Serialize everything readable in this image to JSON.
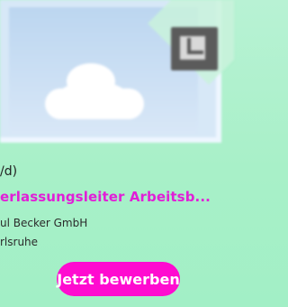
{
  "job": {
    "gender_suffix": "/d)",
    "title": "erlassungsleiter Arbeitsb...",
    "company": "ul Becker GmbH",
    "location": "rlsruhe"
  },
  "cta": {
    "label": "Jetzt bewerben"
  },
  "colors": {
    "background": "#a8f0c8",
    "title": "#e11fd7",
    "cta": "#ff0bd0"
  },
  "icons": {
    "hero_image": "image-placeholder-icon"
  }
}
